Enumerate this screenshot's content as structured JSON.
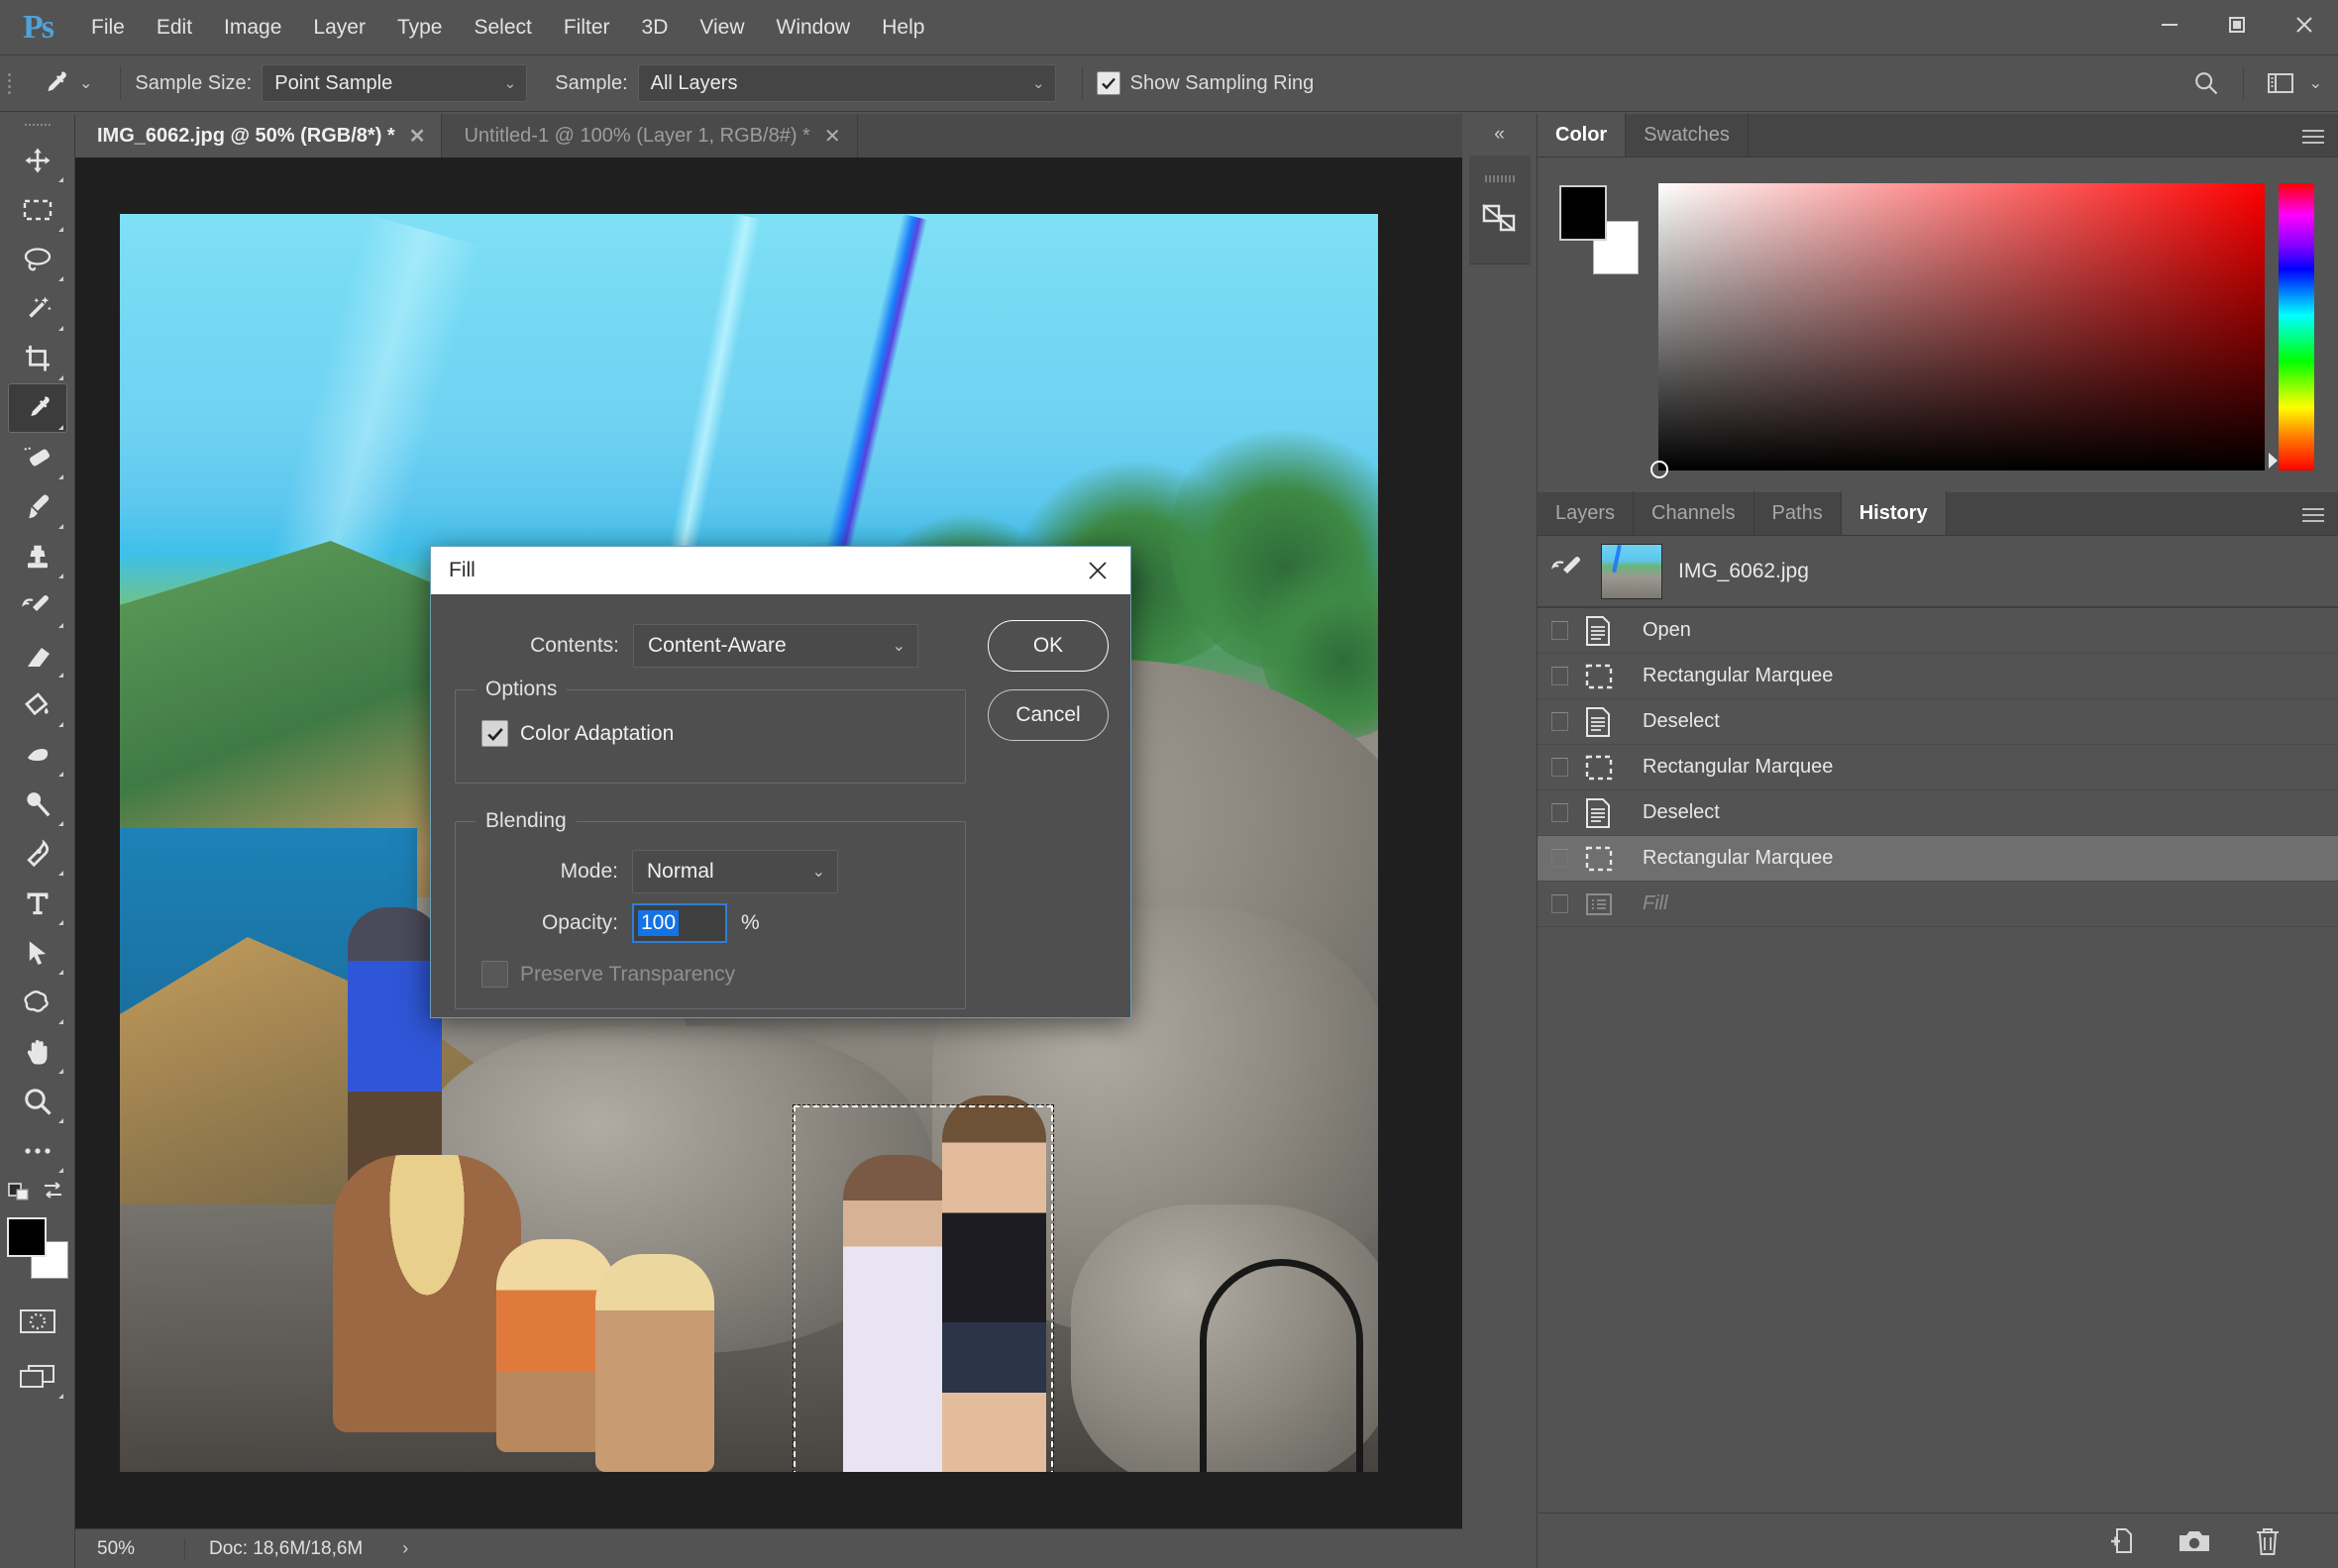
{
  "app": {
    "logo": "Ps"
  },
  "menubar": {
    "items": [
      {
        "label": "File"
      },
      {
        "label": "Edit"
      },
      {
        "label": "Image"
      },
      {
        "label": "Layer"
      },
      {
        "label": "Type"
      },
      {
        "label": "Select"
      },
      {
        "label": "Filter"
      },
      {
        "label": "3D"
      },
      {
        "label": "View"
      },
      {
        "label": "Window"
      },
      {
        "label": "Help"
      }
    ],
    "window_controls": [
      {
        "name": "minimize-button",
        "icon": "minimize-icon"
      },
      {
        "name": "maximize-button",
        "icon": "maximize-icon"
      },
      {
        "name": "close-button",
        "icon": "close-icon"
      }
    ]
  },
  "options_bar": {
    "active_tool_icon": "eyedropper-icon",
    "sample_size": {
      "label": "Sample Size:",
      "value": "Point Sample"
    },
    "sample": {
      "label": "Sample:",
      "value": "All Layers"
    },
    "show_sampling_ring": {
      "label": "Show Sampling Ring",
      "checked": true
    },
    "search_icon": "search-icon",
    "workspace_icon": "workspace-icon"
  },
  "toolbar": {
    "tools": [
      {
        "name": "move-tool",
        "icon": "move-icon",
        "active": false
      },
      {
        "name": "rectangular-marquee-tool",
        "icon": "marquee-icon",
        "active": false
      },
      {
        "name": "lasso-tool",
        "icon": "lasso-icon",
        "active": false
      },
      {
        "name": "object-selection-tool",
        "icon": "magic-wand-icon",
        "active": false
      },
      {
        "name": "crop-tool",
        "icon": "crop-icon",
        "active": false
      },
      {
        "name": "eyedropper-tool",
        "icon": "eyedropper-icon",
        "active": true
      },
      {
        "name": "spot-healing-brush-tool",
        "icon": "healing-brush-icon",
        "active": false
      },
      {
        "name": "brush-tool",
        "icon": "brush-icon",
        "active": false
      },
      {
        "name": "clone-stamp-tool",
        "icon": "stamp-icon",
        "active": false
      },
      {
        "name": "history-brush-tool",
        "icon": "history-brush-icon",
        "active": false
      },
      {
        "name": "eraser-tool",
        "icon": "eraser-icon",
        "active": false
      },
      {
        "name": "gradient-tool",
        "icon": "paint-bucket-icon",
        "active": false
      },
      {
        "name": "blur-tool",
        "icon": "blur-drop-icon",
        "active": false
      },
      {
        "name": "dodge-tool",
        "icon": "dodge-icon",
        "active": false
      },
      {
        "name": "pen-tool",
        "icon": "pen-icon",
        "active": false
      },
      {
        "name": "type-tool",
        "icon": "text-t-icon",
        "active": false
      },
      {
        "name": "path-selection-tool",
        "icon": "arrow-cursor-icon",
        "active": false
      },
      {
        "name": "custom-shape-tool",
        "icon": "shape-blob-icon",
        "active": false
      },
      {
        "name": "hand-tool",
        "icon": "hand-icon",
        "active": false
      },
      {
        "name": "zoom-tool",
        "icon": "magnifier-icon",
        "active": false
      },
      {
        "name": "edit-toolbar-button",
        "icon": "ellipsis-icon",
        "active": false
      }
    ],
    "foreground_color": "#000000",
    "background_color": "#ffffff",
    "default_colors_icon": "default-colors-icon",
    "swap_colors_icon": "swap-colors-icon",
    "quick_mask_icon": "quick-mask-icon",
    "screen_mode_icon": "screen-mode-icon"
  },
  "document_tabs": [
    {
      "label": "IMG_6062.jpg @ 50% (RGB/8*) *",
      "active": true,
      "close_icon": "close-icon"
    },
    {
      "label": "Untitled-1 @ 100% (Layer 1, RGB/8#) *",
      "active": false,
      "close_icon": "close-icon"
    }
  ],
  "status_bar": {
    "zoom": "50%",
    "doc_info": "Doc: 18,6M/18,6M",
    "expand_arrow": "›"
  },
  "dock": {
    "collapse_icon": "«",
    "button_icon": "adjustments-icon"
  },
  "color_panel": {
    "tabs": [
      {
        "label": "Color",
        "active": true
      },
      {
        "label": "Swatches",
        "active": false
      }
    ],
    "menu_icon": "panel-menu-icon",
    "foreground_color": "#000000",
    "background_color": "#ffffff",
    "selected_hue": "#ff0000"
  },
  "history_panel": {
    "tabs": [
      {
        "label": "Layers",
        "active": false
      },
      {
        "label": "Channels",
        "active": false
      },
      {
        "label": "Paths",
        "active": false
      },
      {
        "label": "History",
        "active": true
      }
    ],
    "menu_icon": "panel-menu-icon",
    "source": {
      "label": "IMG_6062.jpg",
      "brush_icon": "history-brush-icon",
      "thumbnail": "document-thumbnail"
    },
    "states": [
      {
        "label": "Open",
        "icon": "document-icon",
        "selected": false,
        "pending": false
      },
      {
        "label": "Rectangular Marquee",
        "icon": "marquee-icon",
        "selected": false,
        "pending": false
      },
      {
        "label": "Deselect",
        "icon": "document-icon",
        "selected": false,
        "pending": false
      },
      {
        "label": "Rectangular Marquee",
        "icon": "marquee-icon",
        "selected": false,
        "pending": false
      },
      {
        "label": "Deselect",
        "icon": "document-icon",
        "selected": false,
        "pending": false
      },
      {
        "label": "Rectangular Marquee",
        "icon": "marquee-icon",
        "selected": true,
        "pending": false
      },
      {
        "label": "Fill",
        "icon": "fill-list-icon",
        "selected": false,
        "pending": true
      }
    ],
    "footer_buttons": [
      {
        "name": "create-document-from-state-button",
        "icon": "new-document-icon"
      },
      {
        "name": "create-new-snapshot-button",
        "icon": "camera-icon"
      },
      {
        "name": "delete-state-button",
        "icon": "trash-icon"
      }
    ]
  },
  "fill_dialog": {
    "title": "Fill",
    "close_icon": "close-icon",
    "contents": {
      "label": "Contents:",
      "value": "Content-Aware"
    },
    "options_group": {
      "legend": "Options",
      "color_adaptation": {
        "label": "Color Adaptation",
        "checked": true
      }
    },
    "blending_group": {
      "legend": "Blending",
      "mode": {
        "label": "Mode:",
        "value": "Normal"
      },
      "opacity": {
        "label": "Opacity:",
        "value": "100",
        "unit": "%"
      },
      "preserve_transparency": {
        "label": "Preserve Transparency",
        "checked": false,
        "disabled": true
      }
    },
    "buttons": {
      "ok": "OK",
      "cancel": "Cancel"
    }
  },
  "canvas": {
    "selection": {
      "visible": true
    }
  }
}
